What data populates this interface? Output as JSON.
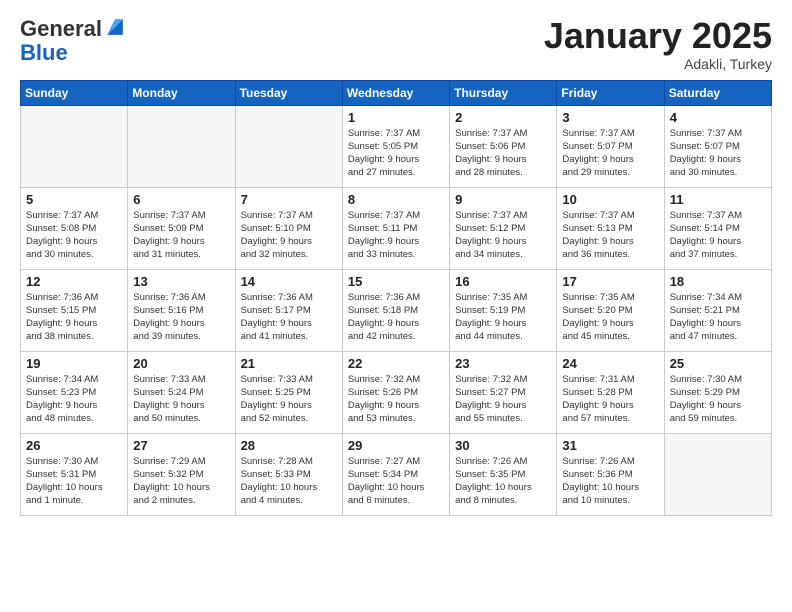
{
  "logo": {
    "general": "General",
    "blue": "Blue"
  },
  "header": {
    "month": "January 2025",
    "location": "Adakli, Turkey"
  },
  "weekdays": [
    "Sunday",
    "Monday",
    "Tuesday",
    "Wednesday",
    "Thursday",
    "Friday",
    "Saturday"
  ],
  "weeks": [
    [
      {
        "day": "",
        "info": ""
      },
      {
        "day": "",
        "info": ""
      },
      {
        "day": "",
        "info": ""
      },
      {
        "day": "1",
        "info": "Sunrise: 7:37 AM\nSunset: 5:05 PM\nDaylight: 9 hours\nand 27 minutes."
      },
      {
        "day": "2",
        "info": "Sunrise: 7:37 AM\nSunset: 5:06 PM\nDaylight: 9 hours\nand 28 minutes."
      },
      {
        "day": "3",
        "info": "Sunrise: 7:37 AM\nSunset: 5:07 PM\nDaylight: 9 hours\nand 29 minutes."
      },
      {
        "day": "4",
        "info": "Sunrise: 7:37 AM\nSunset: 5:07 PM\nDaylight: 9 hours\nand 30 minutes."
      }
    ],
    [
      {
        "day": "5",
        "info": "Sunrise: 7:37 AM\nSunset: 5:08 PM\nDaylight: 9 hours\nand 30 minutes."
      },
      {
        "day": "6",
        "info": "Sunrise: 7:37 AM\nSunset: 5:09 PM\nDaylight: 9 hours\nand 31 minutes."
      },
      {
        "day": "7",
        "info": "Sunrise: 7:37 AM\nSunset: 5:10 PM\nDaylight: 9 hours\nand 32 minutes."
      },
      {
        "day": "8",
        "info": "Sunrise: 7:37 AM\nSunset: 5:11 PM\nDaylight: 9 hours\nand 33 minutes."
      },
      {
        "day": "9",
        "info": "Sunrise: 7:37 AM\nSunset: 5:12 PM\nDaylight: 9 hours\nand 34 minutes."
      },
      {
        "day": "10",
        "info": "Sunrise: 7:37 AM\nSunset: 5:13 PM\nDaylight: 9 hours\nand 36 minutes."
      },
      {
        "day": "11",
        "info": "Sunrise: 7:37 AM\nSunset: 5:14 PM\nDaylight: 9 hours\nand 37 minutes."
      }
    ],
    [
      {
        "day": "12",
        "info": "Sunrise: 7:36 AM\nSunset: 5:15 PM\nDaylight: 9 hours\nand 38 minutes."
      },
      {
        "day": "13",
        "info": "Sunrise: 7:36 AM\nSunset: 5:16 PM\nDaylight: 9 hours\nand 39 minutes."
      },
      {
        "day": "14",
        "info": "Sunrise: 7:36 AM\nSunset: 5:17 PM\nDaylight: 9 hours\nand 41 minutes."
      },
      {
        "day": "15",
        "info": "Sunrise: 7:36 AM\nSunset: 5:18 PM\nDaylight: 9 hours\nand 42 minutes."
      },
      {
        "day": "16",
        "info": "Sunrise: 7:35 AM\nSunset: 5:19 PM\nDaylight: 9 hours\nand 44 minutes."
      },
      {
        "day": "17",
        "info": "Sunrise: 7:35 AM\nSunset: 5:20 PM\nDaylight: 9 hours\nand 45 minutes."
      },
      {
        "day": "18",
        "info": "Sunrise: 7:34 AM\nSunset: 5:21 PM\nDaylight: 9 hours\nand 47 minutes."
      }
    ],
    [
      {
        "day": "19",
        "info": "Sunrise: 7:34 AM\nSunset: 5:23 PM\nDaylight: 9 hours\nand 48 minutes."
      },
      {
        "day": "20",
        "info": "Sunrise: 7:33 AM\nSunset: 5:24 PM\nDaylight: 9 hours\nand 50 minutes."
      },
      {
        "day": "21",
        "info": "Sunrise: 7:33 AM\nSunset: 5:25 PM\nDaylight: 9 hours\nand 52 minutes."
      },
      {
        "day": "22",
        "info": "Sunrise: 7:32 AM\nSunset: 5:26 PM\nDaylight: 9 hours\nand 53 minutes."
      },
      {
        "day": "23",
        "info": "Sunrise: 7:32 AM\nSunset: 5:27 PM\nDaylight: 9 hours\nand 55 minutes."
      },
      {
        "day": "24",
        "info": "Sunrise: 7:31 AM\nSunset: 5:28 PM\nDaylight: 9 hours\nand 57 minutes."
      },
      {
        "day": "25",
        "info": "Sunrise: 7:30 AM\nSunset: 5:29 PM\nDaylight: 9 hours\nand 59 minutes."
      }
    ],
    [
      {
        "day": "26",
        "info": "Sunrise: 7:30 AM\nSunset: 5:31 PM\nDaylight: 10 hours\nand 1 minute."
      },
      {
        "day": "27",
        "info": "Sunrise: 7:29 AM\nSunset: 5:32 PM\nDaylight: 10 hours\nand 2 minutes."
      },
      {
        "day": "28",
        "info": "Sunrise: 7:28 AM\nSunset: 5:33 PM\nDaylight: 10 hours\nand 4 minutes."
      },
      {
        "day": "29",
        "info": "Sunrise: 7:27 AM\nSunset: 5:34 PM\nDaylight: 10 hours\nand 6 minutes."
      },
      {
        "day": "30",
        "info": "Sunrise: 7:26 AM\nSunset: 5:35 PM\nDaylight: 10 hours\nand 8 minutes."
      },
      {
        "day": "31",
        "info": "Sunrise: 7:26 AM\nSunset: 5:36 PM\nDaylight: 10 hours\nand 10 minutes."
      },
      {
        "day": "",
        "info": ""
      }
    ]
  ]
}
